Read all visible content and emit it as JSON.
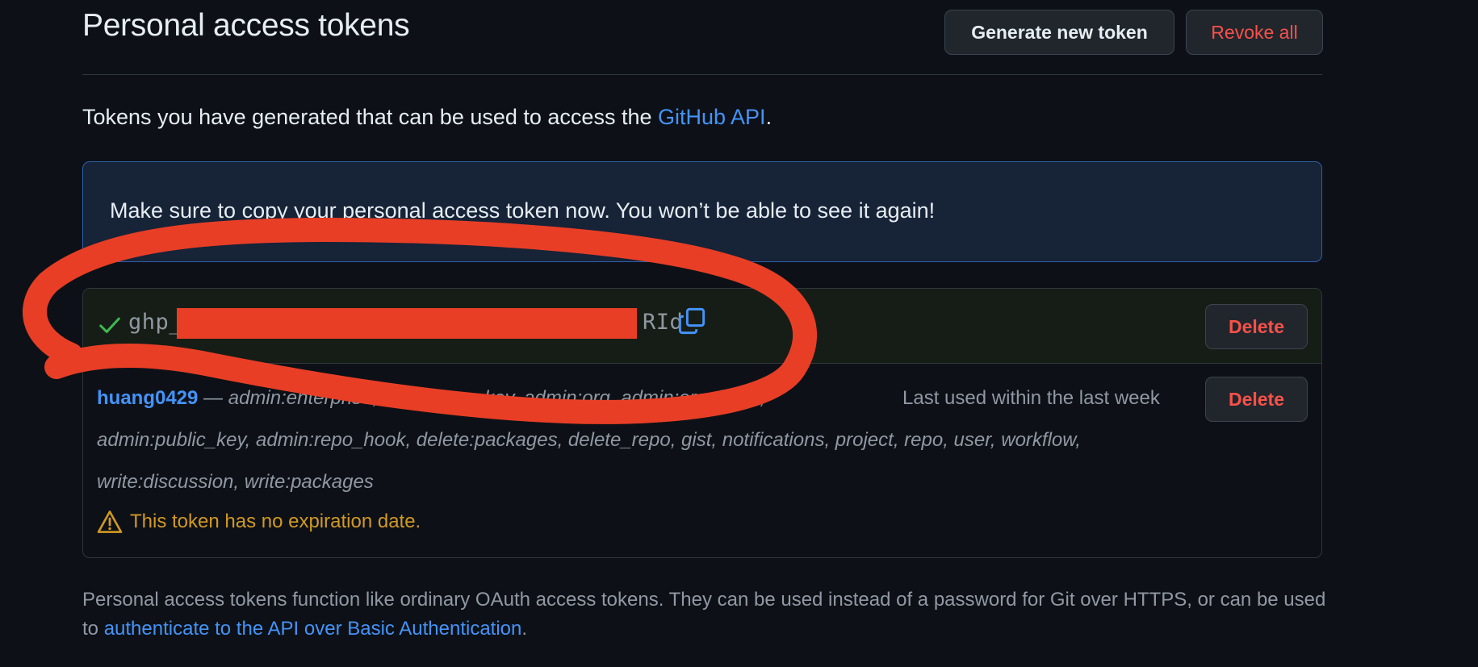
{
  "header": {
    "title": "Personal access tokens",
    "generate_label": "Generate new token",
    "revoke_label": "Revoke all"
  },
  "intro": {
    "text": "Tokens you have generated that can be used to access the ",
    "link": "GitHub API",
    "suffix": "."
  },
  "flash": {
    "message": "Make sure to copy your personal access token now. You won’t be able to see it again!"
  },
  "new_token": {
    "prefix": "ghp_",
    "suffix": "RId",
    "delete_label": "Delete"
  },
  "token": {
    "name": "huang0429",
    "separator": " — ",
    "scope_lines": [
      "admin:enterprise, admin:gpg_key, admin:org, admin:org_hook,",
      "admin:public_key, admin:repo_hook, delete:packages, delete_repo, gist, notifications, project, repo, user, workflow,",
      "write:discussion, write:packages"
    ],
    "last_used": "Last used within the last week",
    "delete_label": "Delete",
    "warning": "This token has no expiration date."
  },
  "footer": {
    "text": "Personal access tokens function like ordinary OAuth access tokens. They can be used instead of a password for Git over HTTPS, or can be used to ",
    "link": "authenticate to the API over Basic Authentication",
    "suffix": "."
  },
  "colors": {
    "background": "#0d1117",
    "link": "#4493f8",
    "danger": "#f85149",
    "warning": "#d29922",
    "success": "#3fb950",
    "annotation": "#e83e26"
  }
}
